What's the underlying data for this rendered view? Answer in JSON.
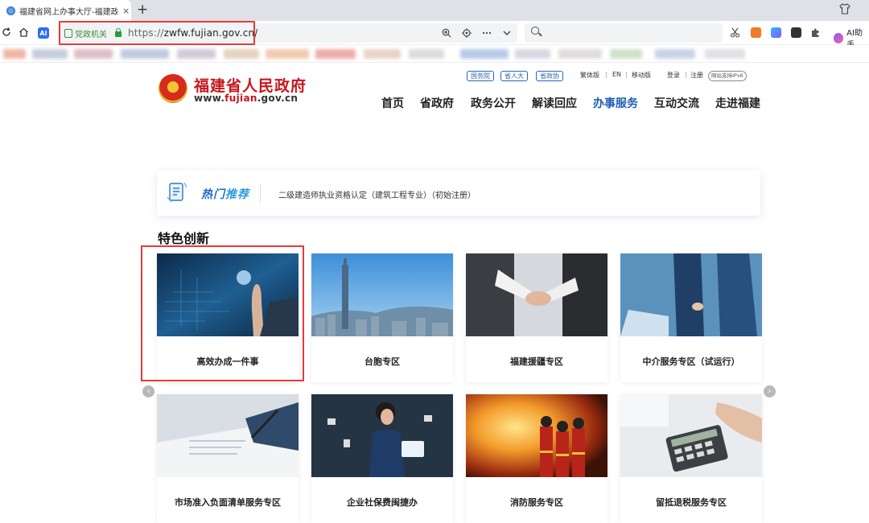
{
  "browser": {
    "tab_title": "福建省网上办事大厅-福建政",
    "tab_close": "×",
    "new_tab": "+",
    "cert_label": "党政机关",
    "url_proto": "https://",
    "url_rest": "zwfw.fujian.gov.cn/",
    "ai_badge": "AI",
    "ai_help": "AI助手",
    "nav_icons": [
      "refresh-icon",
      "home-icon"
    ],
    "address_icons": [
      "zoom-icon",
      "location-icon",
      "more-icon",
      "chevron-down-icon"
    ]
  },
  "site": {
    "title": "福建省人民政府",
    "url_prefix": "www.",
    "url_red": "fujian",
    "url_suffix": ".gov.cn",
    "chips": [
      "国务院",
      "省人大",
      "省政协"
    ],
    "top_links": [
      "繁体版",
      "|",
      "EN",
      "|",
      "移动版",
      "登录",
      "|",
      "注册"
    ],
    "ipv6": "网站支持IPv6",
    "nav": [
      "首页",
      "省政府",
      "政务公开",
      "解读回应",
      "办事服务",
      "互动交流",
      "走进福建"
    ],
    "nav_active": "办事服务"
  },
  "hot": {
    "label_a": "热门",
    "label_b": "推荐",
    "item": "二级建造师执业资格认定（建筑工程专业）（初始注册）"
  },
  "featured": {
    "title": "特色创新",
    "cards": [
      "高效办成一件事",
      "台胞专区",
      "福建援疆专区",
      "中介服务专区（试运行）",
      "市场准入负面清单服务专区",
      "企业社保费闽捷办",
      "消防服务专区",
      "留抵退税服务专区"
    ],
    "prev_arrow": "‹",
    "next_arrow": "›"
  },
  "colors": {
    "brand_red": "#c8161d",
    "link_blue": "#1d5fb4",
    "highlight": "#e8393b"
  }
}
